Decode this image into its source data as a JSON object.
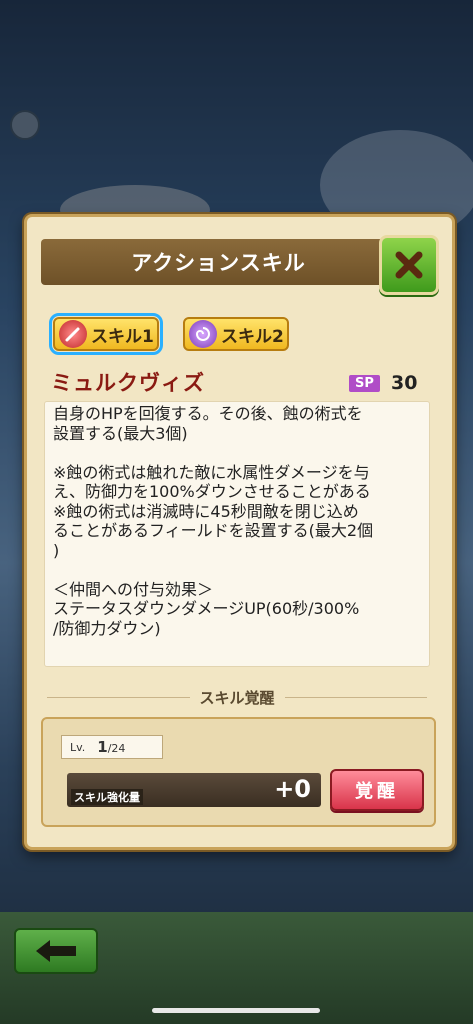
{
  "dialog": {
    "title": "アクションスキル",
    "close_icon": "close-x-icon",
    "tabs": [
      {
        "label": "スキル1",
        "icon": "sword-icon",
        "active": true
      },
      {
        "label": "スキル2",
        "icon": "swirl-icon",
        "active": false
      }
    ],
    "skill_name": "ミュルクヴィズ",
    "sp_label": "SP",
    "sp_value": "30",
    "description": [
      "自身のHPを回復する。その後、蝕の術式を",
      "設置する(最大3個)",
      "",
      "※蝕の術式は触れた敵に水属性ダメージを与",
      "え、防御力を100%ダウンさせることがある",
      "※蝕の術式は消滅時に45秒間敵を閉じ込め",
      "ることがあるフィールドを設置する(最大2個",
      ")",
      "",
      "＜仲間への付与効果＞",
      "ステータスダウンダメージUP(60秒/300%",
      "/防御力ダウン)"
    ],
    "awaken": {
      "header": "スキル覚醒",
      "level_label": "Lv.",
      "level_current": "1",
      "level_max": "/24",
      "gauge_label": "スキル強化量",
      "gauge_value": "+0",
      "button_label": "覚醒"
    }
  },
  "footer": {
    "back_icon": "back-arrow-icon"
  },
  "colors": {
    "accent_green": "#3f9a1c",
    "title_brown": "#6e5128",
    "skill_name_red": "#8a1a12",
    "sp_purple": "#b04cc7",
    "awaken_red": "#d9344a"
  }
}
